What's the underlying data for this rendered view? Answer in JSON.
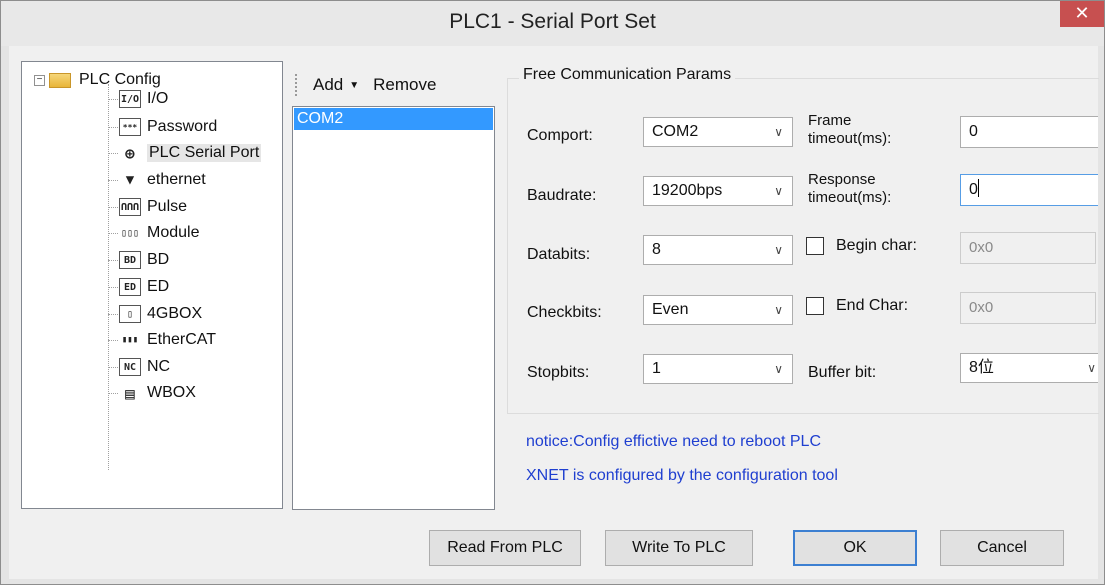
{
  "window": {
    "title": "PLC1 - Serial Port  Set",
    "close_glyph": "✕"
  },
  "tree": {
    "root_label": "PLC Config",
    "expander": "−",
    "items": [
      {
        "label": "I/O",
        "icon": "io-icon",
        "glyph": "I/O"
      },
      {
        "label": "Password",
        "icon": "password-icon",
        "glyph": "***"
      },
      {
        "label": "PLC Serial Port",
        "icon": "serial-port-icon",
        "glyph": "⊕"
      },
      {
        "label": "ethernet",
        "icon": "ethernet-icon",
        "glyph": "▼"
      },
      {
        "label": "Pulse",
        "icon": "pulse-icon",
        "glyph": "ՈՈՈ"
      },
      {
        "label": "Module",
        "icon": "module-icon",
        "glyph": "▯▯▯"
      },
      {
        "label": "BD",
        "icon": "bd-icon",
        "glyph": "BD"
      },
      {
        "label": "ED",
        "icon": "ed-icon",
        "glyph": "ED"
      },
      {
        "label": "4GBOX",
        "icon": "4gbox-icon",
        "glyph": "▯"
      },
      {
        "label": "EtherCAT",
        "icon": "ethercat-icon",
        "glyph": "▮▮▮"
      },
      {
        "label": "NC",
        "icon": "nc-icon",
        "glyph": "NC"
      },
      {
        "label": "WBOX",
        "icon": "wbox-icon",
        "glyph": "▤"
      }
    ]
  },
  "list": {
    "add_label": "Add",
    "add_caret": "▼",
    "remove_label": "Remove",
    "items": [
      "COM2"
    ]
  },
  "params": {
    "group_title": "Free Communication Params",
    "comport_label": "Comport:",
    "comport_value": "COM2",
    "baudrate_label": "Baudrate:",
    "baudrate_value": "19200bps",
    "databits_label": "Databits:",
    "databits_value": "8",
    "checkbits_label": "Checkbits:",
    "checkbits_value": "Even",
    "stopbits_label": "Stopbits:",
    "stopbits_value": "1",
    "frame_timeout_label_1": "Frame",
    "frame_timeout_label_2": "timeout(ms):",
    "frame_timeout_value": "0",
    "response_timeout_label_1": "Response",
    "response_timeout_label_2": "timeout(ms):",
    "response_timeout_value": "0",
    "begin_char_label": "Begin char:",
    "begin_char_value": "0x0",
    "end_char_label": "End Char:",
    "end_char_value": "0x0",
    "buffer_bit_label": "Buffer bit:",
    "buffer_bit_value": "8位",
    "dropdown_arrow": "∨"
  },
  "notices": {
    "line1": "notice:Config effictive need to reboot PLC",
    "line2": "XNET is configured by the configuration tool"
  },
  "buttons": {
    "read": "Read From PLC",
    "write": "Write To PLC",
    "ok": "OK",
    "cancel": "Cancel"
  },
  "colors": {
    "selection": "#3399ff",
    "notice_text": "#1f3fd0",
    "close_button": "#c75050"
  }
}
